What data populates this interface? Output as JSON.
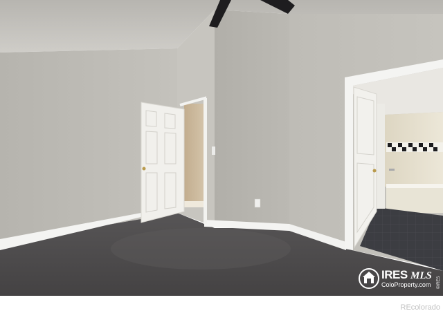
{
  "photo": {
    "subject": "Empty carpeted bedroom with vaulted ceiling, open doors to closet and bathroom",
    "colors": {
      "ceiling": "#c3c1bc",
      "wall_left": "#bdbbb5",
      "wall_center": "#b7b5af",
      "wall_right": "#c0beb8",
      "carpet": "#4d4b4c",
      "trim": "#f4f4f2",
      "door": "#f1f0ec",
      "bath_floor": "#3e3f44",
      "closet_interior": "#cbb99e"
    }
  },
  "watermark": {
    "brand_main": "IRES",
    "brand_sub": "MLS",
    "site": "ColoProperty.com",
    "vertical": "©IRES"
  },
  "footer": {
    "credit": "REcolorado"
  }
}
